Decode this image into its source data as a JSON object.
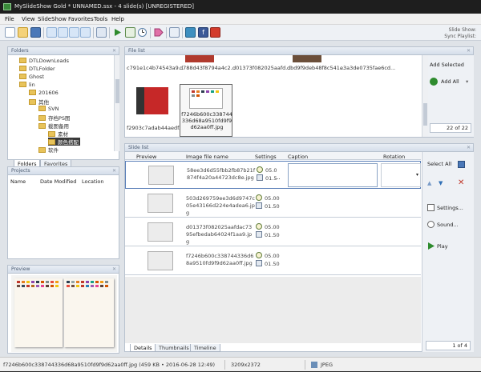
{
  "window": {
    "title": "MySlideShow Gold * UNNAMED.ssx - 4 slide(s)  [UNREGISTERED]"
  },
  "menu": [
    "File",
    "View",
    "SlideShow",
    "Favorites",
    "Tools",
    "Help"
  ],
  "toolbar_status": {
    "slide_show": "Slide Show:",
    "sync_playlist": "Sync Playlist:"
  },
  "folders_panel": {
    "title": "Folders",
    "items": [
      "DTLDownLoads",
      "DTLFolder",
      "Ghost",
      "lin",
      "201606",
      "其他",
      "SVN",
      "存档PS图",
      "截图备用",
      "素材",
      "颜色搭配",
      "软件"
    ],
    "tabs": [
      "Folders",
      "Favorites"
    ]
  },
  "projects_panel": {
    "title": "Projects",
    "columns": [
      "Name",
      "Date Modified",
      "Location"
    ]
  },
  "preview_panel": {
    "title": "Preview"
  },
  "file_list": {
    "title": "File list",
    "items": [
      "c791e1c4b74543a9...",
      "d788d43f8794a4c2...",
      "d01373f082025aafd...",
      "dbd9f9deb48f8c541...",
      "e3a3de0735fae6cd...",
      "f2903c7adab44aedf...",
      "f7246b600c338744336d68a9510fd9f9d62aa0ff.jpg"
    ],
    "add_selected": "Add Selected",
    "add_all": "Add All",
    "counter": "22 of 22"
  },
  "slide_list": {
    "title": "Slide list",
    "columns": [
      "Preview",
      "Image file name",
      "Settings",
      "Caption",
      "Rotation"
    ],
    "rows": [
      {
        "file": "58ee3d6d55fbb2fb87b21f874f4a20a44723dc8e.jpg",
        "duration": "05.0",
        "transition": "01.5",
        "more": "..."
      },
      {
        "file": "503d269759ee3d6d9747c05e43166d224e4adea6.jpg",
        "duration": "05.00",
        "transition": "01.50"
      },
      {
        "file": "d01373f082025aafdac7395efbedab64024f1aa9.jpg",
        "duration": "05.00",
        "transition": "01.50"
      },
      {
        "file": "f7246b600c338744336d68a9510fd9f9d62aa0ff.jpg",
        "duration": "05.00",
        "transition": "01.50"
      }
    ],
    "tabs": [
      "Details",
      "Thumbnails",
      "Timeline"
    ],
    "select_all": "Select All",
    "settings": "Settings...",
    "sound": "Sound...",
    "play": "Play",
    "counter": "1 of 4"
  },
  "statusbar": {
    "file": "f7246b600c338744336d68a9510fd9f9d62aa0ff.jpg  (459 KB • 2016-06-28 12:49)",
    "dimensions": "3209x2372",
    "format": "JPEG"
  },
  "colors": {
    "accent": "#2f6fb5",
    "panel_border": "#b8c2cf",
    "workspace": "#dfe3e8",
    "titlebar": "#1e1e1e"
  }
}
